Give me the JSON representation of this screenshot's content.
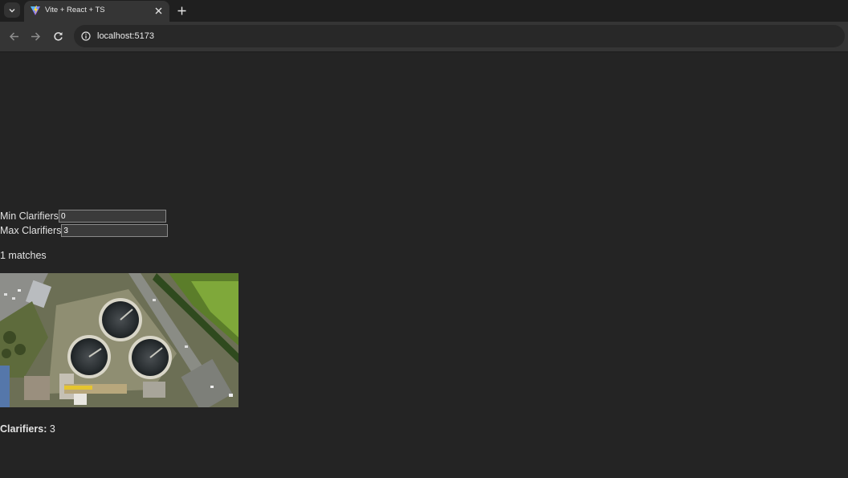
{
  "browser": {
    "tab_title": "Vite + React + TS",
    "url": "localhost:5173"
  },
  "filters": {
    "min_label": "Min Clarifiers",
    "min_value": "0",
    "max_label": "Max Clarifiers",
    "max_value": "3"
  },
  "results": {
    "count_text": "1 matches",
    "items": [
      {
        "label": "Clarifiers:",
        "value": "3"
      }
    ]
  },
  "colors": {
    "page_bg": "#242424",
    "text": "rgba(255,255,255,0.87)",
    "toolbar_bg": "#353535",
    "tabstrip_bg": "#1f1f1f"
  },
  "icons": [
    "tab-list-icon",
    "vite-favicon-icon",
    "close-icon",
    "plus-icon",
    "back-arrow-icon",
    "forward-arrow-icon",
    "reload-icon",
    "info-icon"
  ]
}
